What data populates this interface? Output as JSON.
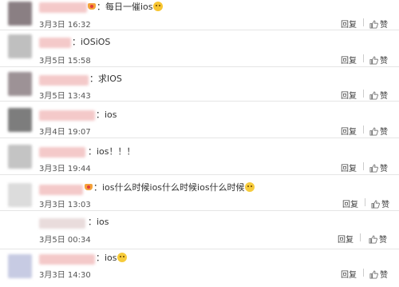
{
  "comments": [
    {
      "text": "：每日一催ios",
      "badge": true,
      "emoji": "tongue-emoji",
      "time": "3月3日 16:32"
    },
    {
      "text": "：iOSiOS",
      "badge": false,
      "emoji": "",
      "time": "3月5日 15:58"
    },
    {
      "text": "：求IOS",
      "badge": false,
      "emoji": "",
      "time": "3月5日 13:43"
    },
    {
      "text": "：ios",
      "badge": false,
      "emoji": "",
      "time": "3月4日 19:07"
    },
    {
      "text": "：ios！！！",
      "badge": false,
      "emoji": "",
      "time": "3月3日 19:44"
    },
    {
      "text": "：ios什么时候ios什么时候ios什么时候",
      "badge": true,
      "emoji": "crying-emoji",
      "time": "3月3日 13:03"
    },
    {
      "text": "：ios",
      "badge": false,
      "emoji": "",
      "time": "3月5日 00:34"
    },
    {
      "text": "：ios",
      "badge": false,
      "emoji": "crying-emoji",
      "time": "3月3日 14:30"
    }
  ],
  "actions": {
    "reply_label": "回复",
    "like_label": "赞"
  },
  "colors": {
    "divider": "#e5e5e5",
    "text": "#333333",
    "meta": "#555555"
  }
}
